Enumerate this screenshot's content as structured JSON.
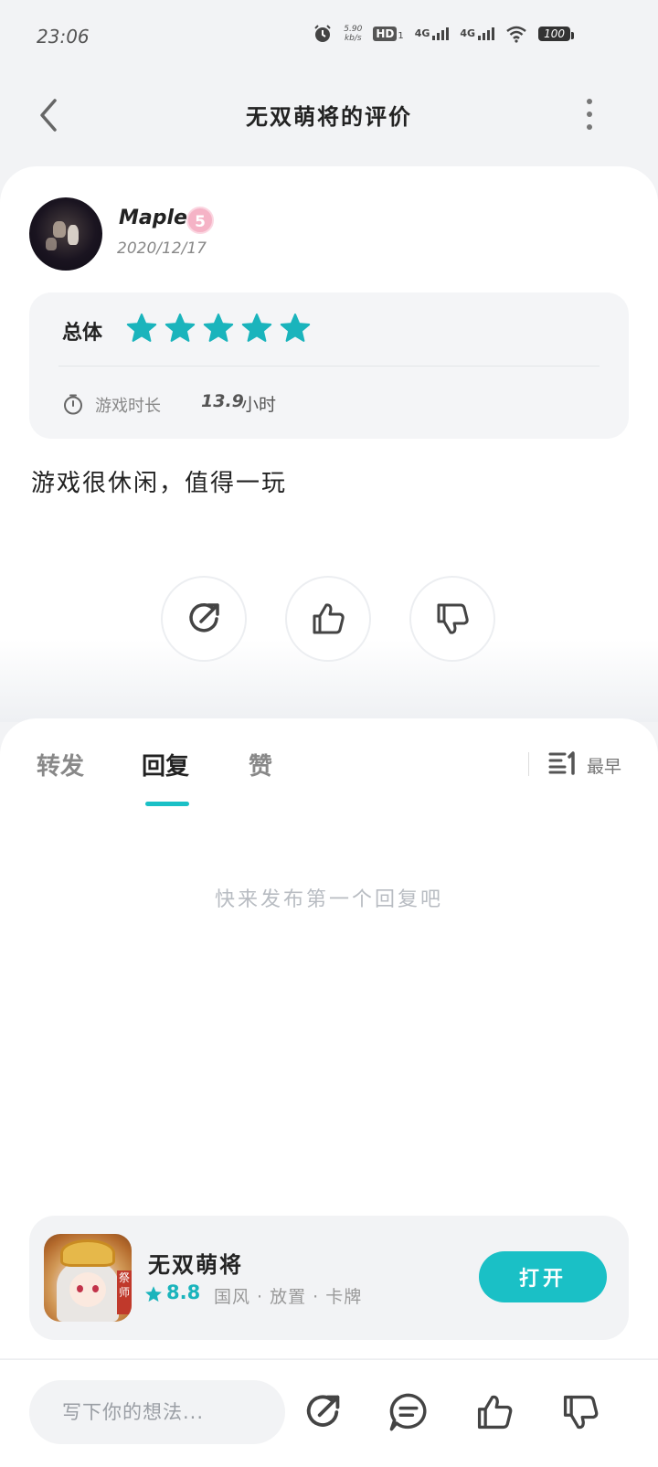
{
  "status_bar": {
    "time": "23:06",
    "net_speed_value": "5.90",
    "net_speed_unit": "kb/s",
    "hd_label": "HD",
    "sim_index": "1",
    "signal1_label": "4G",
    "signal2_label": "4G",
    "battery": "100"
  },
  "header": {
    "title": "无双萌将的评价"
  },
  "review": {
    "username": "Maple",
    "level": "5",
    "date": "2020/12/17",
    "rating_label": "总体",
    "stars": 5,
    "playtime_label": "游戏时长",
    "playtime_value": "13.9",
    "playtime_unit": "小时",
    "text": "游戏很休闲，值得一玩"
  },
  "tabs": {
    "items": [
      "转发",
      "回复",
      "赞"
    ],
    "active_index": 1,
    "sort_label": "最早",
    "empty_message": "快来发布第一个回复吧"
  },
  "app": {
    "name": "无双萌将",
    "rating": "8.8",
    "tags": "国风 · 放置 · 卡牌",
    "icon_badge": "祭师",
    "open_label": "打开"
  },
  "bottom_bar": {
    "input_placeholder": "写下你的想法..."
  },
  "colors": {
    "accent": "#1ac0c6",
    "star": "#1ab4bc",
    "background": "#f2f3f5"
  }
}
